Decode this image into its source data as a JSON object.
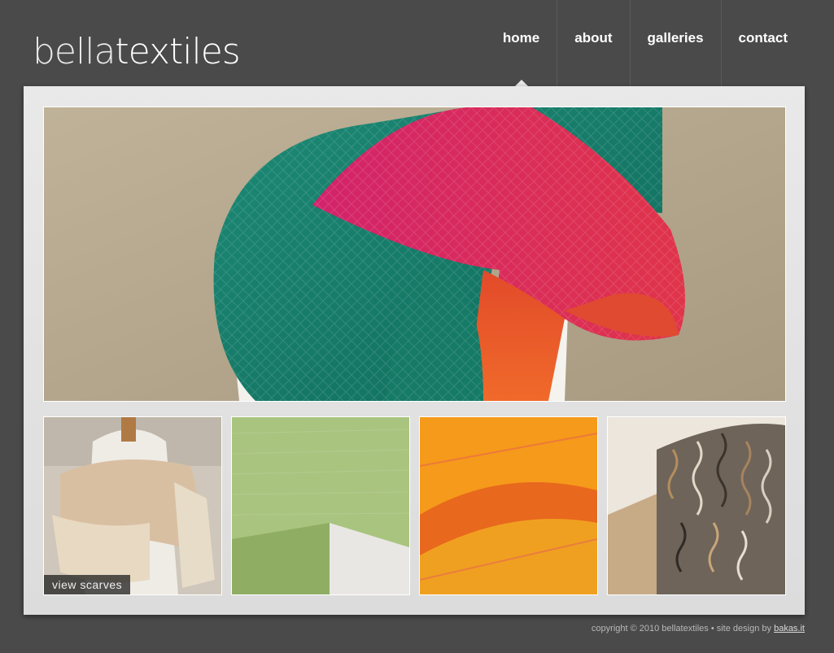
{
  "brand": {
    "logo_light": "bella",
    "logo_bold": "textiles"
  },
  "nav": {
    "items": [
      {
        "label": "home",
        "active": true
      },
      {
        "label": "about",
        "active": false
      },
      {
        "label": "galleries",
        "active": false
      },
      {
        "label": "contact",
        "active": false
      }
    ]
  },
  "hero": {
    "image": "draped teal pink orange woven scarf on mannequin"
  },
  "thumbnails": [
    {
      "image": "cream beige fringed scarf on mannequin",
      "label": "view scarves"
    },
    {
      "image": "green lace knit scarf",
      "label": ""
    },
    {
      "image": "orange pink woven fabric closeup",
      "label": ""
    },
    {
      "image": "curly wool fleece",
      "label": ""
    }
  ],
  "footer": {
    "text": "copyright © 2010 bellatextiles • site design by",
    "link": "bakas.it"
  },
  "colors": {
    "background": "#4a4a4a",
    "panel": "#e5e5e5",
    "text": "#ffffff"
  }
}
